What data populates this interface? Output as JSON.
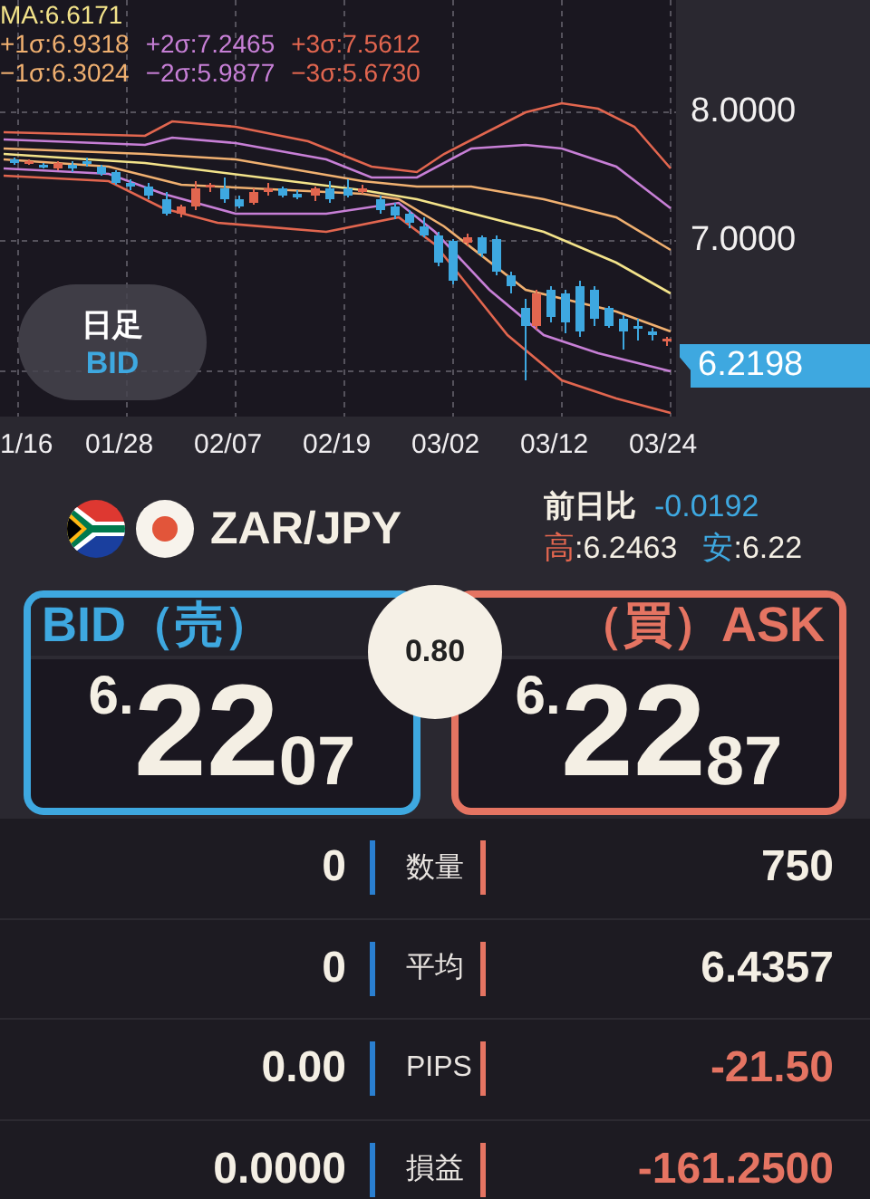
{
  "chart": {
    "legend": [
      [
        {
          "text": "MA:6.6171",
          "color": "#f3e38a"
        }
      ],
      [
        {
          "text": "+1σ:6.9318",
          "color": "#f0b070"
        },
        {
          "text": "+2σ:7.2465",
          "color": "#c77fd6"
        },
        {
          "text": "+3σ:7.5612",
          "color": "#e2664f"
        }
      ],
      [
        {
          "text": "−1σ:6.3024",
          "color": "#f0b070"
        },
        {
          "text": "−2σ:5.9877",
          "color": "#c77fd6"
        },
        {
          "text": "−3σ:5.6730",
          "color": "#e2664f"
        }
      ]
    ],
    "y_labels": [
      "8.0000",
      "7.0000"
    ],
    "current_price": "6.2198",
    "x_labels": [
      "1/16",
      "01/28",
      "02/07",
      "02/19",
      "03/02",
      "03/12",
      "03/24"
    ],
    "period": "日足",
    "side": "BID"
  },
  "quote": {
    "pair": "ZAR/JPY",
    "change_label": "前日比",
    "change": "-0.0192",
    "high_label": "高",
    "high": ":6.2463",
    "low_label": "安",
    "low": ":6.22"
  },
  "spread": "0.80",
  "bid": {
    "label": "BID（売）",
    "head": "6.",
    "big": "22",
    "tail": "07"
  },
  "ask": {
    "label": "（買）ASK",
    "head": "6.",
    "big": "22",
    "tail": "87"
  },
  "rows": [
    {
      "bid": "0",
      "label": "数量",
      "ask": "750",
      "ask_negative": false
    },
    {
      "bid": "0",
      "label": "平均",
      "ask": "6.4357",
      "ask_negative": false
    },
    {
      "bid": "0.00",
      "label": "PIPS",
      "ask": "-21.50",
      "ask_negative": true
    },
    {
      "bid": "0.0000",
      "label": "損益",
      "ask": "-161.2500",
      "ask_negative": true
    }
  ]
}
